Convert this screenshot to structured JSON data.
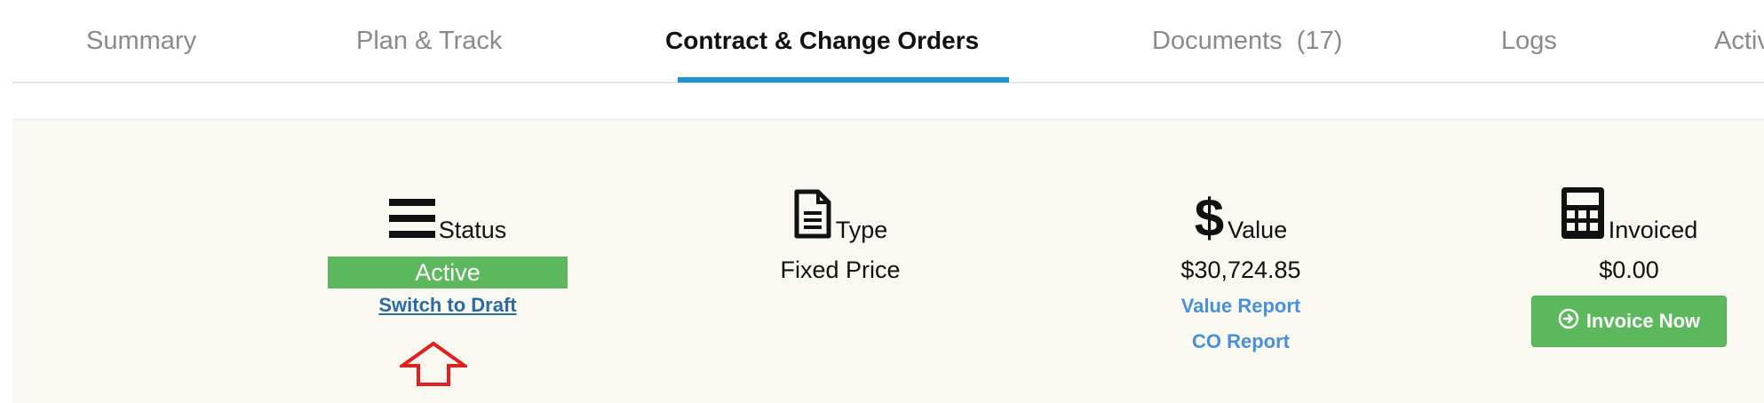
{
  "tabs": [
    {
      "label": "Summary"
    },
    {
      "label": "Plan & Track"
    },
    {
      "label": "Contract & Change Orders"
    },
    {
      "label": "Documents"
    },
    {
      "label": "Logs"
    },
    {
      "label": "Activi"
    }
  ],
  "documents_count": "(17)",
  "active_tab": "Contract & Change Orders",
  "summary": {
    "status": {
      "icon": "list-icon",
      "label": "Status",
      "value": "Active",
      "action": "Switch to Draft"
    },
    "type": {
      "icon": "document-icon",
      "label": "Type",
      "value": "Fixed Price"
    },
    "value": {
      "icon": "dollar-icon",
      "label": "Value",
      "value": "$30,724.85",
      "links": [
        "Value Report",
        "CO Report"
      ]
    },
    "invoiced": {
      "icon": "calculator-icon",
      "label": "Invoiced",
      "value": "$0.00",
      "button": "Invoice Now"
    }
  },
  "colors": {
    "accent": "#1f93d2",
    "success": "#5cb85c",
    "link": "#4a90d9",
    "panel_bg": "#f9f8f1",
    "annotation": "#e0201f"
  }
}
